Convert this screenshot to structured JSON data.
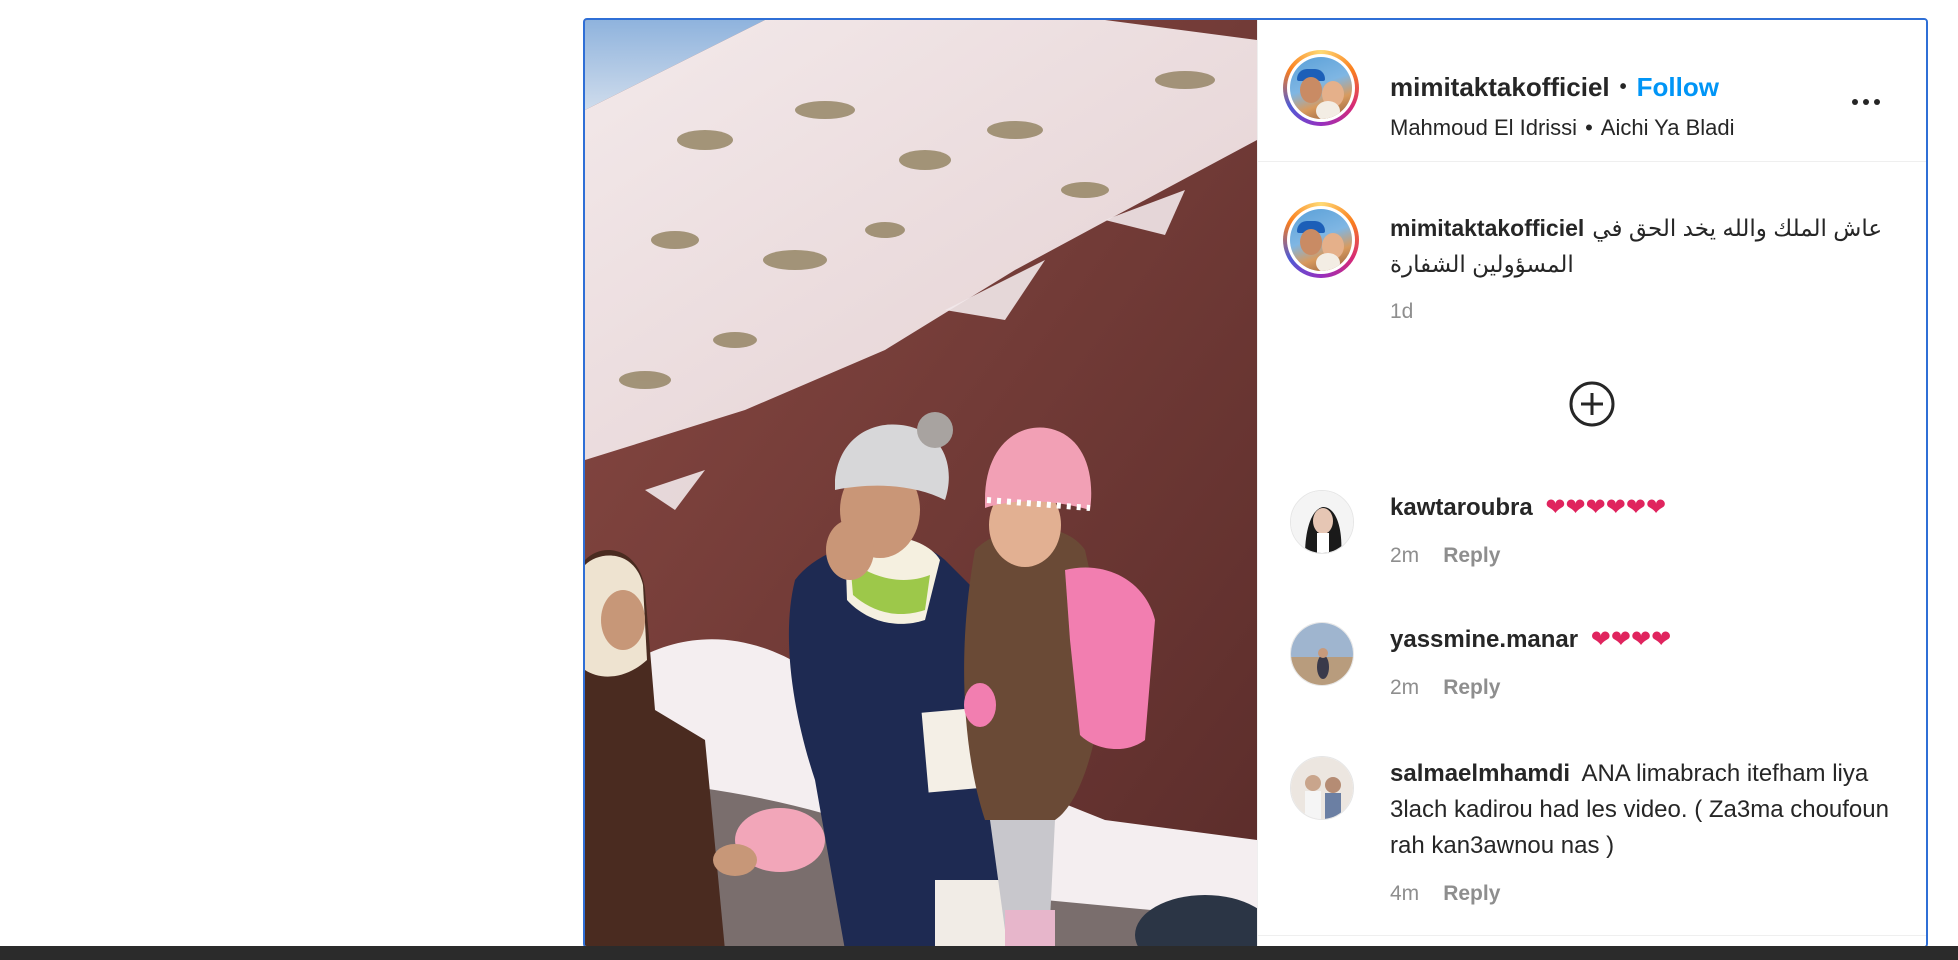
{
  "post": {
    "author": "mimitaktakofficiel",
    "separator": "•",
    "follow_label": "Follow",
    "audio_artist": "Mahmoud El Idrissi",
    "audio_title": "Aichi Ya Bladi",
    "more_label": "More options",
    "caption_username": "mimitaktakofficiel",
    "caption_text": "عاش الملك والله يخد الحق في المسؤولين الشفارة",
    "caption_time": "1d",
    "load_more_label": "Load more comments"
  },
  "comments": [
    {
      "username": "kawtaroubra",
      "text": "",
      "hearts": "❤❤❤❤❤❤",
      "time": "2m",
      "reply": "Reply"
    },
    {
      "username": "yassmine.manar",
      "text": "",
      "hearts": "❤❤❤❤",
      "time": "2m",
      "reply": "Reply"
    },
    {
      "username": "salmaelmhamdi",
      "text": "ANA limabrach itefham liya 3lach kadirou had les video. ( Za3ma choufoun rah kan3awnou nas )",
      "hearts": "",
      "time": "4m",
      "reply": "Reply"
    }
  ],
  "colors": {
    "accent": "#0095f6",
    "text": "#262626",
    "muted": "#8e8e8e",
    "heart": "#e0245e",
    "selection_border": "#2f6fd6"
  },
  "icons": {
    "more": "more-horizontal-icon",
    "load_more": "plus-circle-icon"
  }
}
